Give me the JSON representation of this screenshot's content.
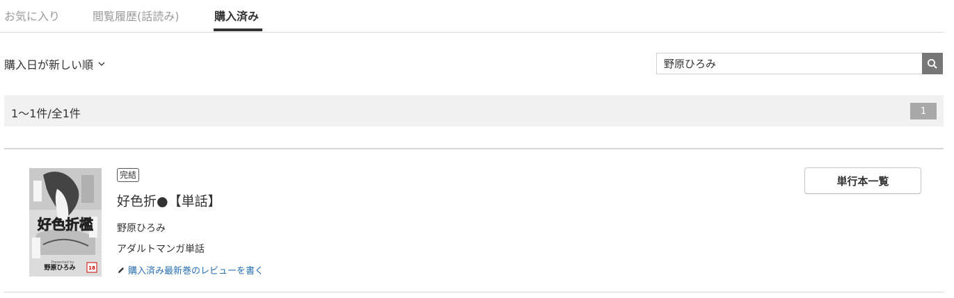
{
  "tabs": [
    {
      "label": "お気に入り"
    },
    {
      "label": "閲覧履歴(話読み)"
    },
    {
      "label": "購入済み"
    }
  ],
  "sort": {
    "label": "購入日が新しい順"
  },
  "search": {
    "value": "野原ひろみ"
  },
  "results": {
    "count_text": "1〜1件/全1件",
    "page": "1"
  },
  "item": {
    "badge": "完結",
    "title": "好色折●【単話】",
    "author": "野原ひろみ",
    "genre": "アダルトマンガ単話",
    "review_link": "購入済み最新巻のレビューを書く",
    "volumes_button": "単行本一覧",
    "cover": {
      "title_text": "好色折檻",
      "author_text": "野原ひろみ",
      "rating": "18",
      "presented": "Presented by"
    }
  },
  "colors": {
    "accent": "#333333",
    "link": "#2a6fb0",
    "search_button": "#777777",
    "page_badge": "#a8a8a8"
  }
}
